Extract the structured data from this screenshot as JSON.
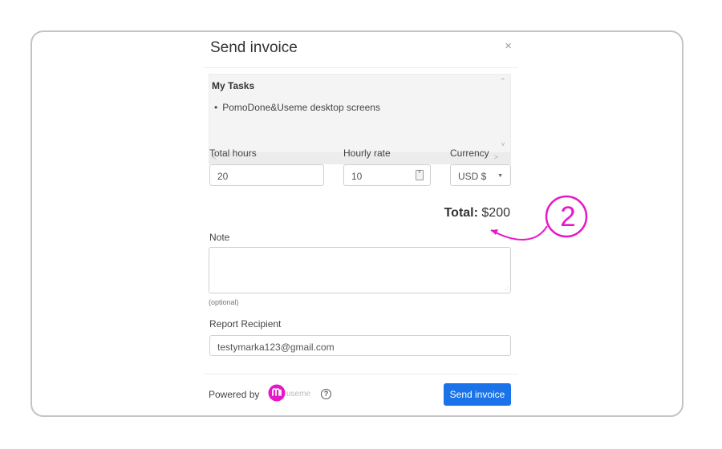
{
  "modal": {
    "title": "Send invoice",
    "close_glyph": "×",
    "close_icon": "close-icon"
  },
  "tasks": {
    "heading": "My Tasks",
    "items": [
      "PomoDone&Useme desktop screens"
    ],
    "scroll_up_glyph": "^",
    "scroll_down_glyph": "v",
    "scroll_left_glyph": "<",
    "scroll_right_glyph": ">"
  },
  "form": {
    "total_hours_label": "Total hours",
    "total_hours_value": "20",
    "hourly_rate_label": "Hourly rate",
    "hourly_rate_value": "10",
    "currency_label": "Currency",
    "currency_value": "USD $",
    "currency_arrow_glyph": "▼",
    "spinner_glyph": "⇳"
  },
  "total": {
    "label": "Total:",
    "value": "$200"
  },
  "note": {
    "label": "Note",
    "value": "",
    "helper": "(optional)",
    "resize_glyph": ".:"
  },
  "recipient": {
    "label": "Report Recipient",
    "value": "testymarka123@gmail.com"
  },
  "footer": {
    "powered_by": "Powered by",
    "brand_text": "useme",
    "help_glyph": "?",
    "send_label": "Send invoice"
  },
  "annotation": {
    "step_number": "2",
    "color": "#e617c7"
  },
  "colors": {
    "primary_button": "#1a73e8",
    "brand": "#e617c7"
  }
}
